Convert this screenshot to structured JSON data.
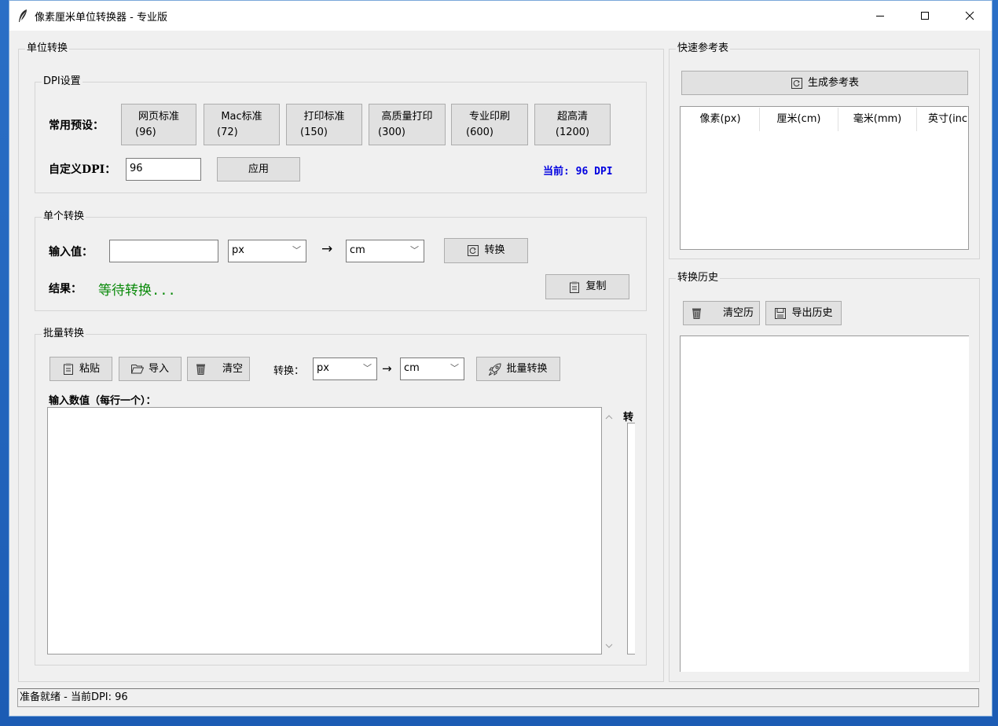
{
  "window": {
    "title": "像素厘米单位转换器 - 专业版",
    "controls": [
      "minimize",
      "maximize",
      "close"
    ]
  },
  "unit_convert": {
    "legend": "单位转换",
    "dpi": {
      "legend": "DPI设置",
      "presets_label": "常用预设：",
      "presets": [
        {
          "name": "网页标准",
          "value": "(96)"
        },
        {
          "name": "Mac标准",
          "value": "(72)"
        },
        {
          "name": "打印标准",
          "value": "(150)"
        },
        {
          "name": "高质量打印",
          "value": "(300)"
        },
        {
          "name": "专业印刷",
          "value": "(600)"
        },
        {
          "name": "超高清",
          "value": "(1200)"
        }
      ],
      "custom_label": "自定义DPI：",
      "custom_value": "96",
      "apply_label": "应用",
      "current_text": "当前: 96 DPI"
    },
    "single": {
      "legend": "单个转换",
      "input_label": "输入值：",
      "input_value": "",
      "from_unit": "px",
      "arrow": "→",
      "to_unit": "cm",
      "convert_label": "转换",
      "result_label": "结果：",
      "result_value": "等待转换...",
      "copy_label": "复制"
    },
    "batch": {
      "legend": "批量转换",
      "paste_label": "粘贴",
      "import_label": "导入",
      "clear_label": "清空",
      "convert_label": "转换：",
      "from_unit": "px",
      "arrow": "→",
      "to_unit": "cm",
      "batch_convert_label": "批量转换",
      "input_label": "输入数值（每行一个）：",
      "output_label": "转"
    }
  },
  "quick_ref": {
    "legend": "快速参考表",
    "generate_label": "生成参考表",
    "columns": [
      "像素(px)",
      "厘米(cm)",
      "毫米(mm)",
      "英寸(inc"
    ]
  },
  "history": {
    "legend": "转换历史",
    "clear_label": "清空历",
    "export_label": "导出历史"
  },
  "status": {
    "text": "准备就绪 - 当前DPI: 96"
  }
}
